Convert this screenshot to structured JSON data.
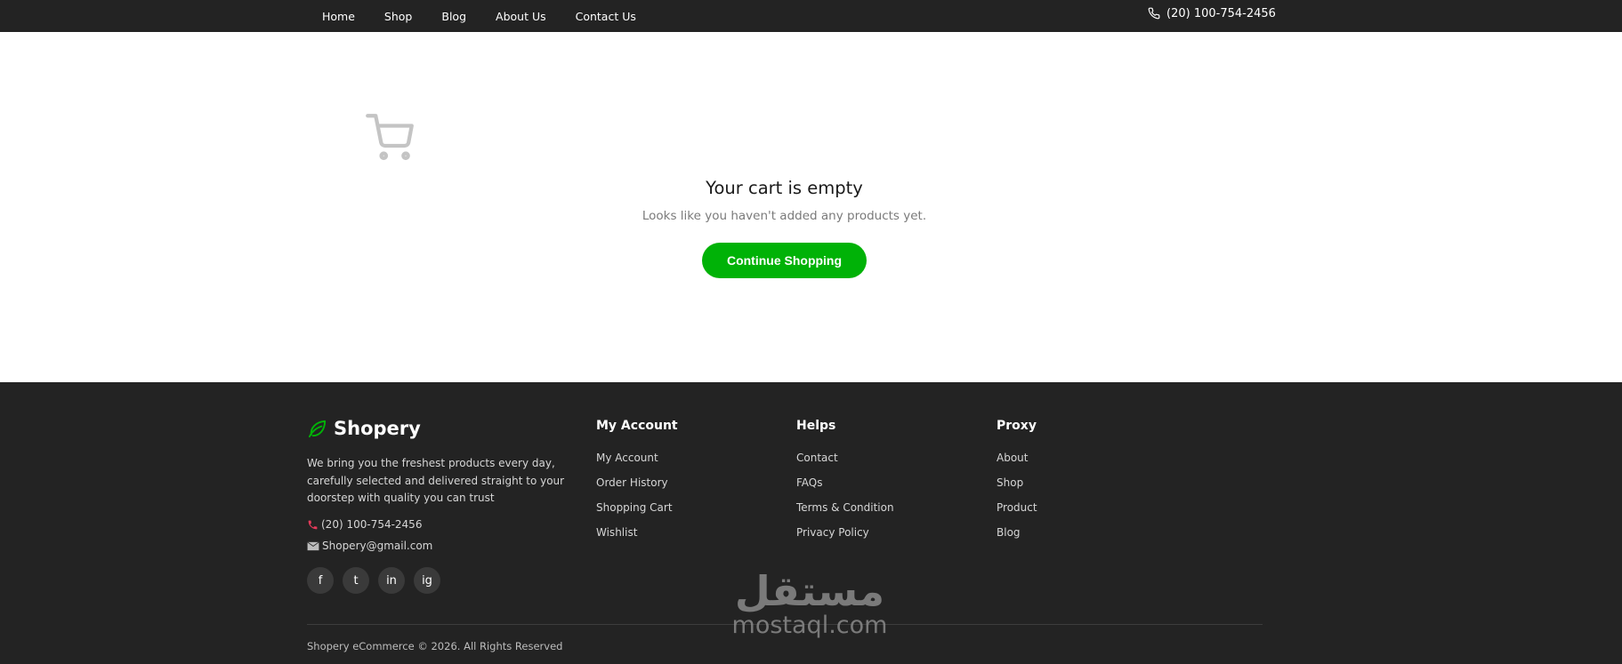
{
  "nav": {
    "links": [
      "Home",
      "Shop",
      "Blog",
      "About Us",
      "Contact Us"
    ],
    "phone": "(20) 100-754-2456"
  },
  "empty_cart": {
    "title": "Your cart is empty",
    "subtitle": "Looks like you haven't added any products yet.",
    "button_label": "Continue Shopping"
  },
  "footer": {
    "brand": "Shopery",
    "about": "We bring you the freshest products every day, carefully selected and delivered straight to your doorstep with quality you can trust",
    "phone": "(20) 100-754-2456",
    "email": "Shopery@gmail.com",
    "socials": [
      "f",
      "t",
      "in",
      "ig"
    ],
    "columns": [
      {
        "title": "My Account",
        "links": [
          "My Account",
          "Order History",
          "Shopping Cart",
          "Wishlist"
        ]
      },
      {
        "title": "Helps",
        "links": [
          "Contact",
          "FAQs",
          "Terms & Condition",
          "Privacy Policy"
        ]
      },
      {
        "title": "Proxy",
        "links": [
          "About",
          "Shop",
          "Product",
          "Blog"
        ]
      }
    ],
    "copyright": "Shopery eCommerce © 2026. All Rights Reserved"
  },
  "watermark": {
    "arabic": "مستقل",
    "latin": "mostaql.com"
  },
  "colors": {
    "accent": "#00b207",
    "dark": "#232323"
  }
}
